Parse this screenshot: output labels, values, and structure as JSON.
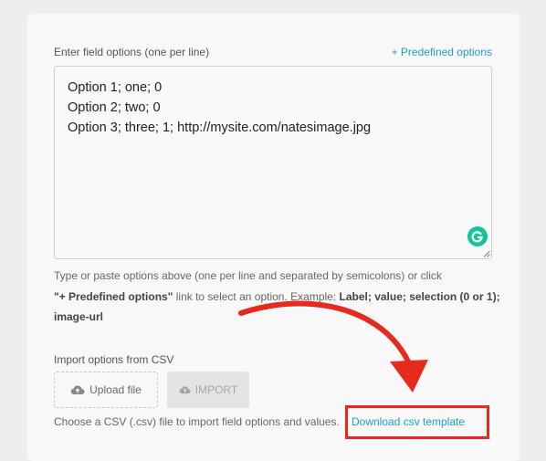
{
  "field_options": {
    "label": "Enter field options (one per line)",
    "predefined_link": "+ Predefined options",
    "lines": [
      "Option 1; one; 0",
      "Option 2; two; 0",
      "Option 3; three; 1; http://mysite.com/natesimage.jpg"
    ],
    "help": {
      "part1": "Type or paste options above (one per line and separated by semicolons) or click",
      "bold1": "\"+ Predefined options\"",
      "part2": " link to select an option. Example: ",
      "bold2": "Label; value; selection (0 or 1); image-url"
    }
  },
  "import_csv": {
    "label": "Import options from CSV",
    "upload_button": "Upload file",
    "import_button": "IMPORT",
    "help_text": "Choose a CSV (.csv) file to import field options and values.",
    "download_link": "Download csv template"
  },
  "colors": {
    "link": "#1e9ec4",
    "annotation": "#e62b1e",
    "grammarly": "#15c39a"
  },
  "icons": {
    "upload": "cloud-upload-icon",
    "import": "cloud-upload-icon",
    "grammarly": "grammarly-icon",
    "resize": "resize-grip-icon"
  }
}
